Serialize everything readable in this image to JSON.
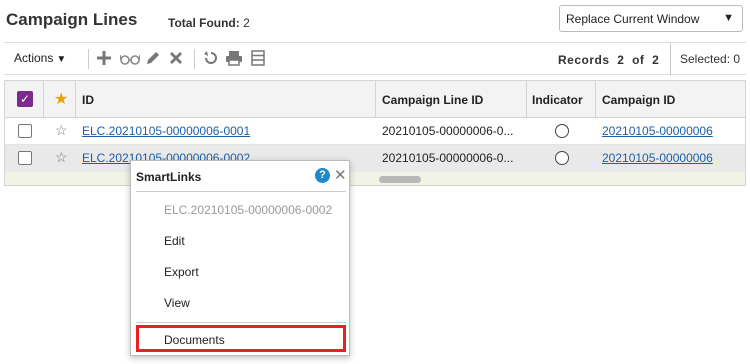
{
  "header": {
    "title": "Campaign Lines",
    "total_found_label": "Total Found:",
    "total_found_value": "2",
    "window_select": {
      "selected": "Replace Current Window",
      "icon": "chevron-down-icon"
    }
  },
  "toolbar": {
    "actions_label": "Actions",
    "records_label": "Records",
    "records_current": "2",
    "records_of": "of",
    "records_total": "2",
    "selected_label": "Selected:",
    "selected_value": "0",
    "icons": [
      "add-icon",
      "glasses-icon",
      "edit-icon",
      "delete-icon",
      "refresh-icon",
      "print-icon",
      "columns-icon"
    ]
  },
  "grid": {
    "columns": [
      "ID",
      "Campaign Line ID",
      "Indicator",
      "Campaign ID"
    ],
    "rows": [
      {
        "id": "ELC.20210105-00000006-0001",
        "campaign_line_id": "20210105-00000006-0...",
        "campaign_id": "20210105-00000006"
      },
      {
        "id": "ELC.20210105-00000006-0002",
        "campaign_line_id": "20210105-00000006-0...",
        "campaign_id": "20210105-00000006"
      }
    ]
  },
  "smartlinks": {
    "title": "SmartLinks",
    "record": "ELC.20210105-00000006-0002",
    "items": [
      "Edit",
      "Export",
      "View"
    ],
    "documents": "Documents",
    "highlight_color": "#e8231f"
  },
  "colors": {
    "accent_purple": "#7b2a8f",
    "link": "#1a5fa8",
    "star": "#e2a400"
  }
}
